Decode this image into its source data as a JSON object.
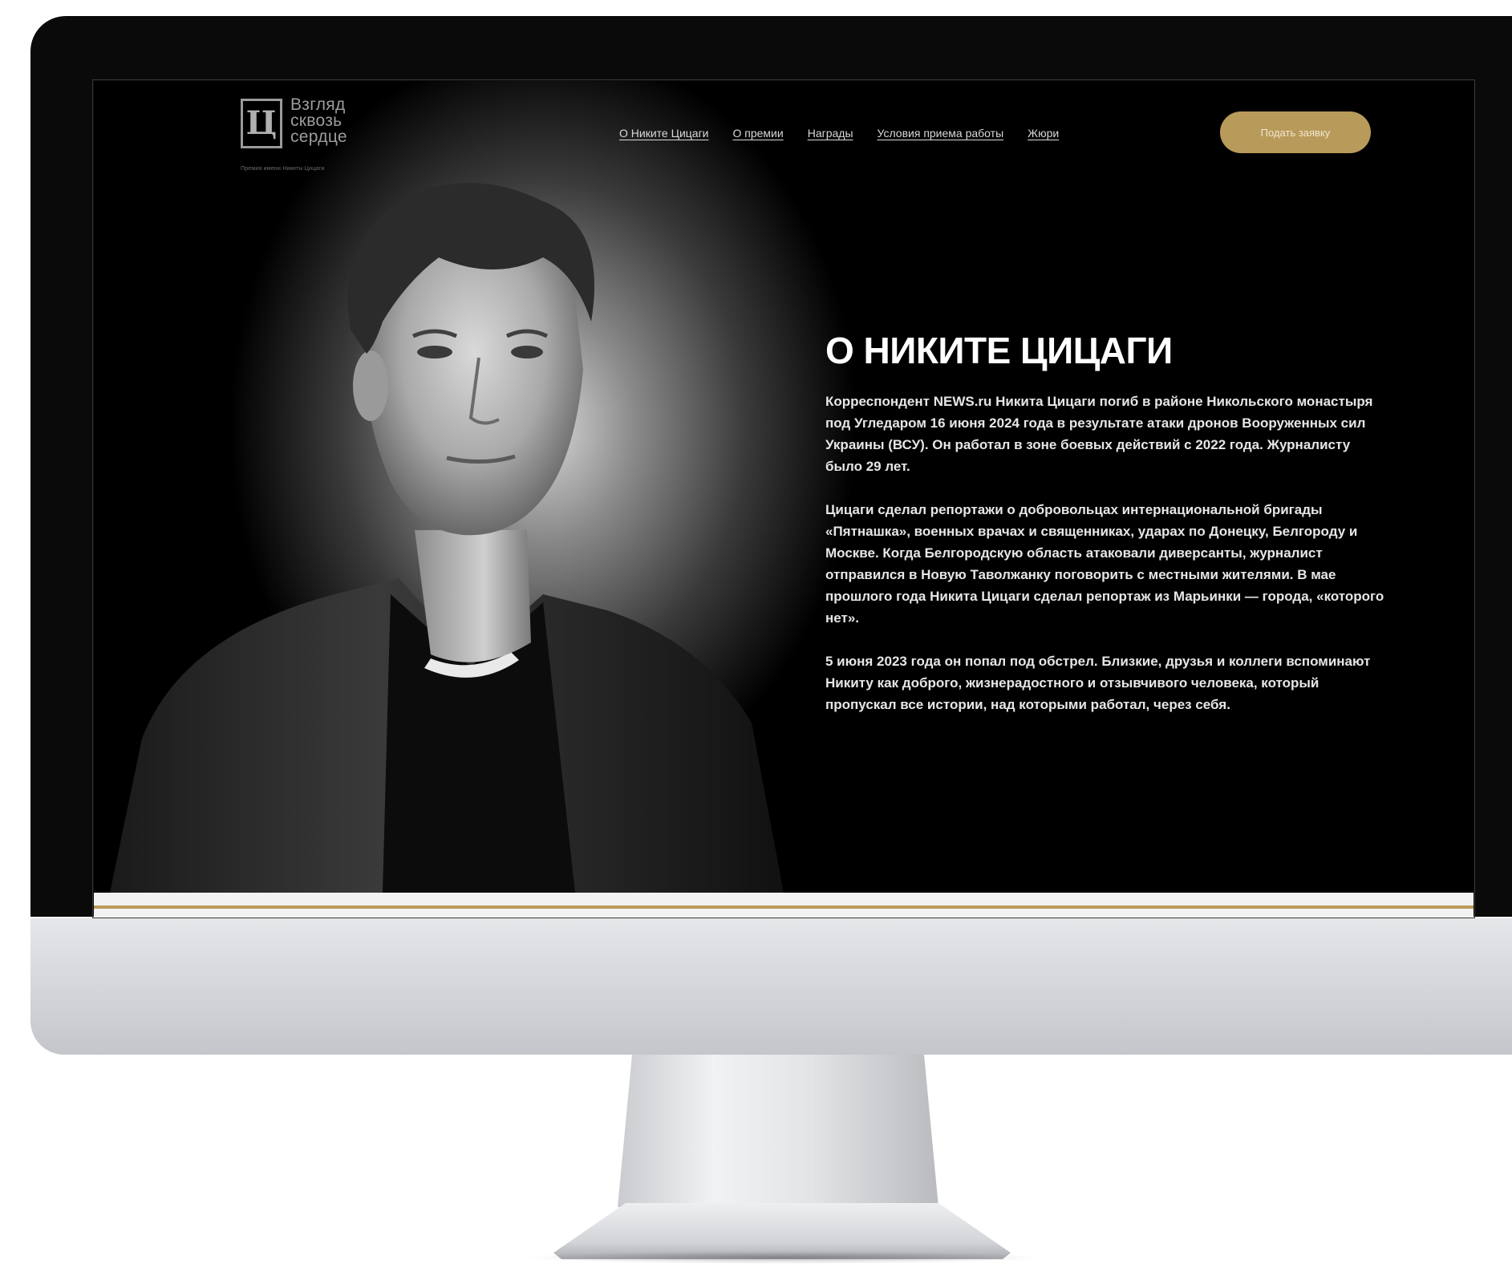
{
  "header": {
    "logo": {
      "mark": "Ц",
      "lines": [
        "Взгляд",
        "сквозь",
        "сердце"
      ],
      "subtitle": "Премия имени Никиты Цицаги"
    },
    "nav": [
      {
        "label": "О Никите Цицаги"
      },
      {
        "label": "О премии"
      },
      {
        "label": "Награды"
      },
      {
        "label": "Условия приема работы"
      },
      {
        "label": "Жюри"
      }
    ],
    "cta_label": "Подать заявку"
  },
  "main": {
    "title": "О НИКИТЕ ЦИЦАГИ",
    "paragraphs": [
      "Корреспондент NEWS.ru Никита Цицаги погиб в районе Никольского монастыря под Угледаром 16 июня 2024 года в результате атаки дронов Вооруженных сил Украины (ВСУ). Он работал в зоне боевых действий с 2022 года. Журналисту было 29 лет.",
      "Цицаги сделал репортажи о добровольцах интернациональной бригады «Пятнашка», военных врачах и священниках, ударах по Донецку, Белгороду и Москве. Когда Белгородскую область атаковали диверсанты, журналист отправился в Новую Таволжанку поговорить с местными жителями. В мае прошлого года Никита Цицаги сделал репортаж из Марьинки — города, «которого нет».",
      "5 июня 2023 года он попал под обстрел. Близкие, друзья и коллеги вспоминают Никиту как доброго, жизнерадостного и отзывчивого человека, который пропускал все истории, над которыми работал, через себя."
    ]
  },
  "colors": {
    "accent_gold": "#b89a5a",
    "background": "#000000",
    "text": "#ffffff"
  }
}
